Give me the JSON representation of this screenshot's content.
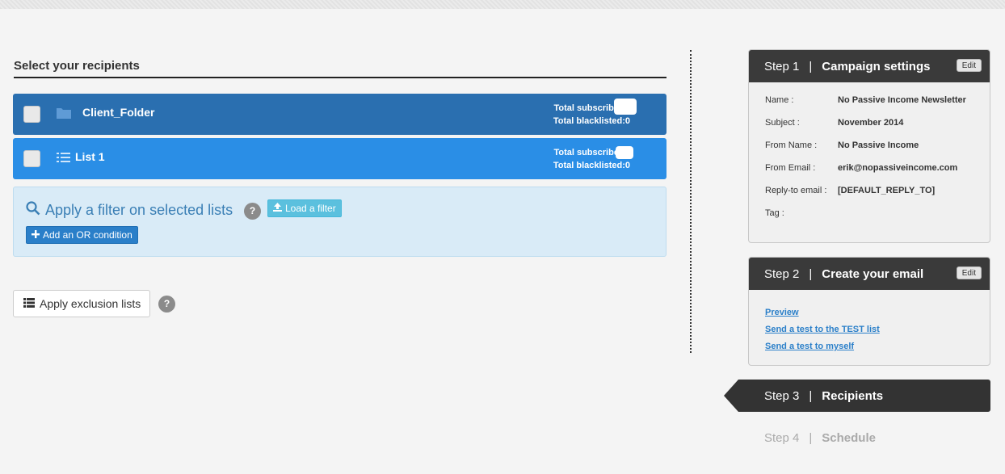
{
  "recipients": {
    "section_title": "Select your recipients",
    "lists": [
      {
        "name": "Client_Folder",
        "type": "folder",
        "subscribers_label": "Total subscribers:",
        "blacklisted_label": "Total blacklisted:0"
      },
      {
        "name": "List 1",
        "type": "list",
        "subscribers_label": "Total subscribers:",
        "blacklisted_label": "Total blacklisted:0"
      }
    ],
    "filter": {
      "title": "Apply a filter on selected lists",
      "help": "?",
      "load_label": "Load a filter",
      "or_label": "Add an OR condition"
    },
    "exclusion": {
      "label": "Apply exclusion lists",
      "help": "?"
    }
  },
  "steps": {
    "sep": "|",
    "step1": {
      "num": "Step 1",
      "label": "Campaign settings",
      "edit": "Edit",
      "fields": [
        {
          "key": "Name :",
          "value": "No Passive Income Newsletter"
        },
        {
          "key": "Subject :",
          "value": "November 2014"
        },
        {
          "key": "From Name :",
          "value": "No Passive Income"
        },
        {
          "key": "From Email :",
          "value": "erik@nopassiveincome.com"
        },
        {
          "key": "Reply-to email :",
          "value": "[DEFAULT_REPLY_TO]"
        },
        {
          "key": "Tag :",
          "value": ""
        }
      ]
    },
    "step2": {
      "num": "Step 2",
      "label": "Create your email",
      "edit": "Edit",
      "links": [
        "Preview",
        "Send a test to the TEST list",
        "Send a test to myself"
      ]
    },
    "step3": {
      "num": "Step 3",
      "label": "Recipients"
    },
    "step4": {
      "num": "Step 4",
      "label": "Schedule"
    }
  },
  "colors": {
    "folder_row": "#2a6fb0",
    "list_row": "#2a8ee6",
    "step_dark": "#3a3a3a",
    "filter_bg": "#d9ebf7"
  }
}
